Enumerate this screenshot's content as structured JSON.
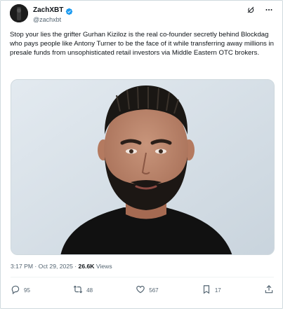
{
  "author": {
    "display_name": "ZachXBT",
    "handle": "@zachxbt",
    "verified": true
  },
  "tweet": {
    "text": "Stop your lies the grifter Gurhan Kiziloz is the real co-founder secretly behind Blockdag who pays people like Antony Turner to be the face of it while transferring away millions in presale funds from unsophisticated retail investors via Middle Eastern OTC brokers.",
    "time": "3:17 PM",
    "separator": "·",
    "date": "Oct 29, 2025",
    "views_count": "26.6K",
    "views_label": "Views"
  },
  "actions": {
    "replies": "95",
    "reposts": "48",
    "likes": "567",
    "bookmarks": "17"
  },
  "icons": {
    "verified": "verified-badge-icon",
    "grok": "grok-icon",
    "more": "more-icon",
    "reply": "reply-icon",
    "repost": "repost-icon",
    "like": "like-icon",
    "bookmark": "bookmark-icon",
    "share": "share-icon"
  },
  "colors": {
    "verified_blue": "#1d9bf0",
    "text_primary": "#0f1419",
    "text_secondary": "#536471",
    "border": "#cfd9de"
  }
}
